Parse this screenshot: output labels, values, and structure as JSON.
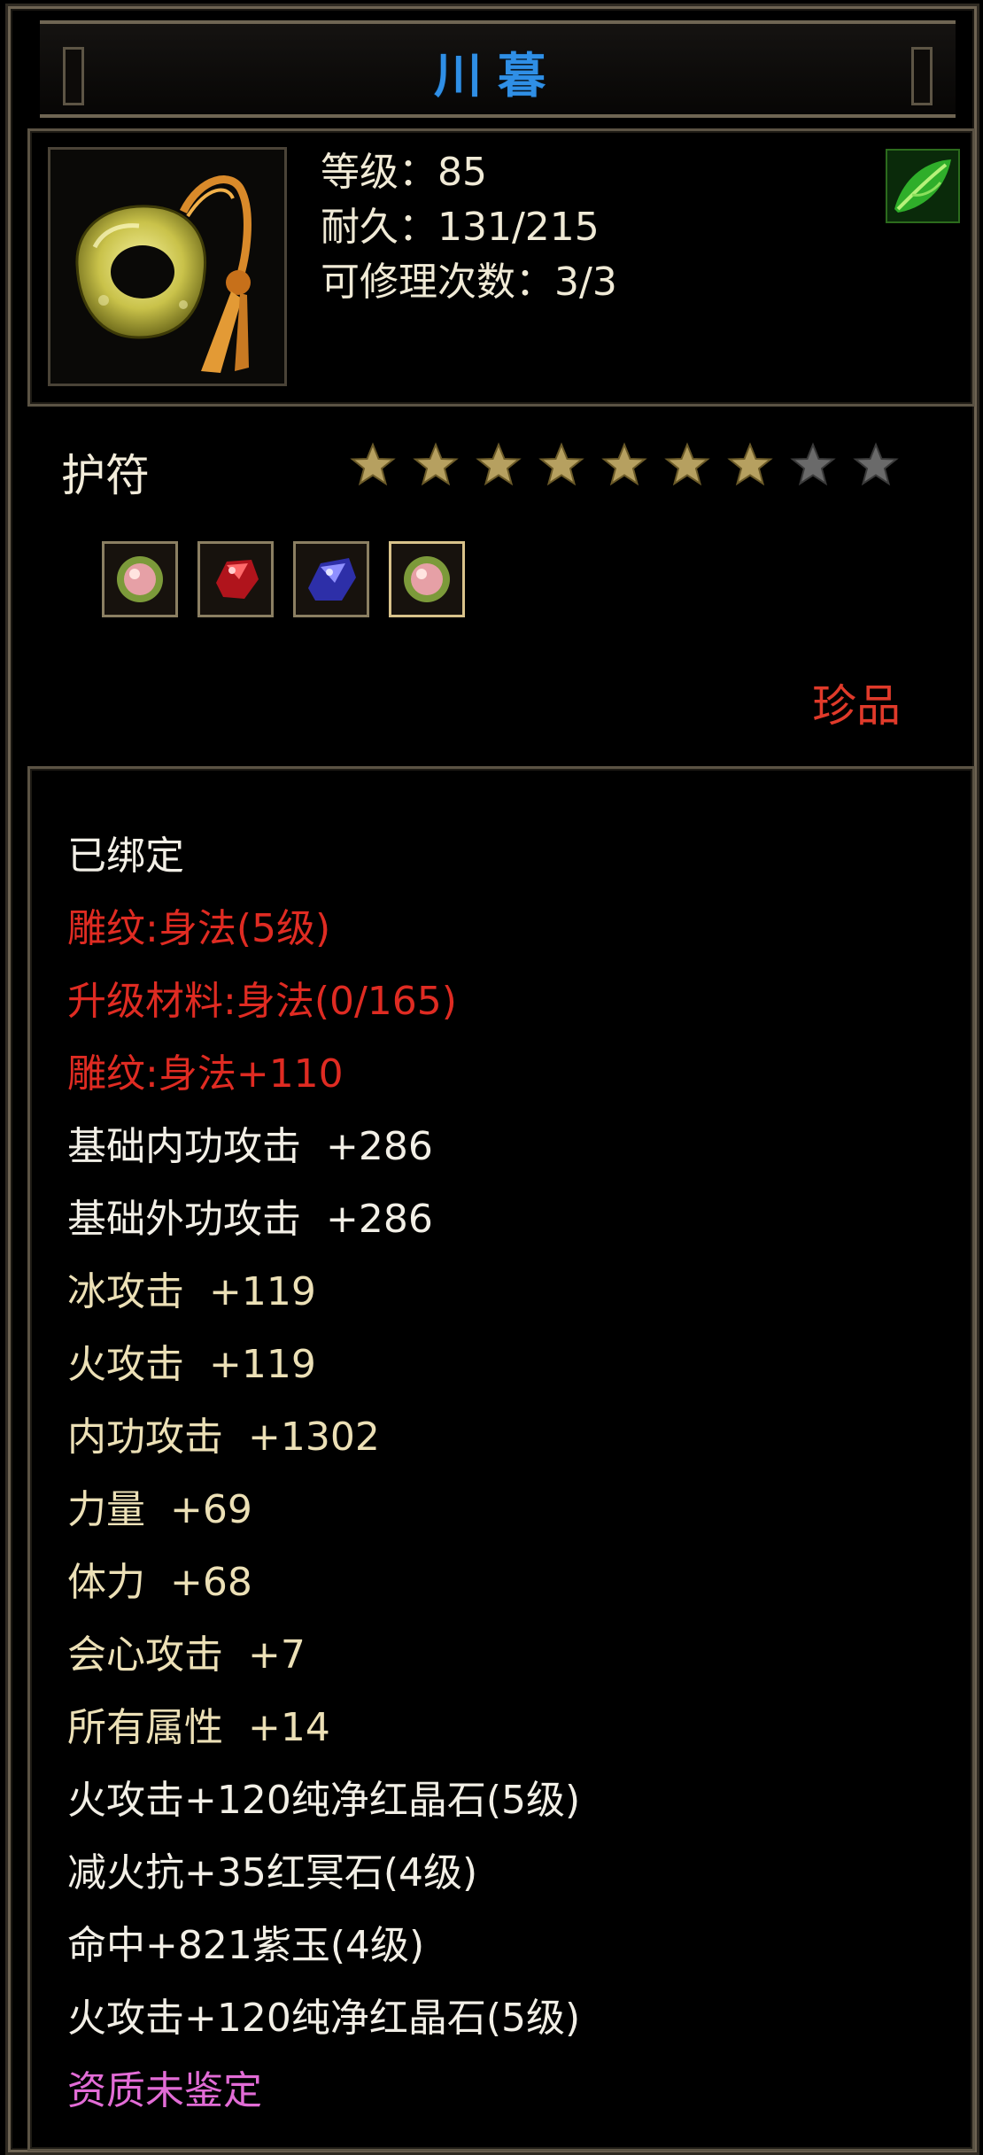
{
  "item": {
    "name": "川暮",
    "stats": {
      "level": "等级：85",
      "durability": "耐久：131/215",
      "repairs": "可修理次数：3/3"
    },
    "type": "护符",
    "stars": {
      "filled": 7,
      "total": 9
    },
    "rarity": "珍品",
    "gems": [
      "pink-gem-icon",
      "red-gem-icon",
      "blue-gem-icon",
      "pink-gem-icon"
    ]
  },
  "properties": [
    {
      "text": "已绑定",
      "color": "white"
    },
    {
      "text": "雕纹:身法(5级)",
      "color": "red"
    },
    {
      "text": "升级材料:身法(0/165)",
      "color": "red"
    },
    {
      "text": "雕纹:身法+110",
      "color": "red"
    },
    {
      "text": "基础内功攻击  +286",
      "color": "white"
    },
    {
      "text": "基础外功攻击  +286",
      "color": "white"
    },
    {
      "text": "冰攻击  +119",
      "color": "cream"
    },
    {
      "text": "火攻击  +119",
      "color": "cream"
    },
    {
      "text": "内功攻击  +1302",
      "color": "cream"
    },
    {
      "text": "力量  +69",
      "color": "cream"
    },
    {
      "text": "体力  +68",
      "color": "cream"
    },
    {
      "text": "会心攻击  +7",
      "color": "cream"
    },
    {
      "text": "所有属性  +14",
      "color": "cream"
    },
    {
      "text": "火攻击+120纯净红晶石(5级)",
      "color": "white"
    },
    {
      "text": "减火抗+35红冥石(4级)",
      "color": "white"
    },
    {
      "text": "命中+821紫玉(4级)",
      "color": "white"
    },
    {
      "text": "火攻击+120纯净红晶石(5级)",
      "color": "white"
    },
    {
      "text": "资质未鉴定",
      "color": "pink"
    }
  ],
  "colors": {
    "title": "#2f8fe6",
    "red": "#df2b22",
    "cream": "#ece0b6",
    "pink": "#e26cd6",
    "star_filled": "#b6a060",
    "star_empty": "#6a6a6a"
  }
}
